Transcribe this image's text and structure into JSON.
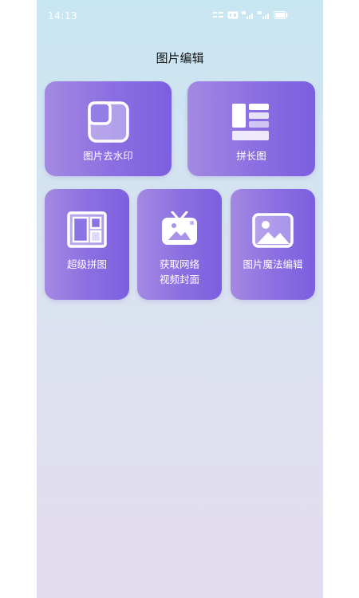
{
  "status_bar": {
    "time": "14:13",
    "icons": [
      "speed-readout-icon",
      "hd-badge-icon",
      "5g-signal-icon",
      "4g-signal-icon",
      "battery-icon"
    ]
  },
  "header": {
    "title": "图片编辑"
  },
  "tools": {
    "watermark": {
      "label": "图片去水印",
      "icon": "crop-frame-icon"
    },
    "long_image": {
      "label": "拼长图",
      "icon": "stacked-tiles-icon"
    },
    "collage": {
      "label": "超级拼图",
      "icon": "collage-layout-icon"
    },
    "video_cover": {
      "label_line1": "获取网络",
      "label_line2": "视频封面",
      "icon": "tv-image-icon"
    },
    "magic_edit": {
      "label": "图片魔法编辑",
      "icon": "landscape-picture-icon"
    }
  },
  "colors": {
    "card_start": "#a489e2",
    "card_end": "#7b5fe0",
    "background_top": "#c8e6f2",
    "background_bottom": "#e3dbee"
  }
}
